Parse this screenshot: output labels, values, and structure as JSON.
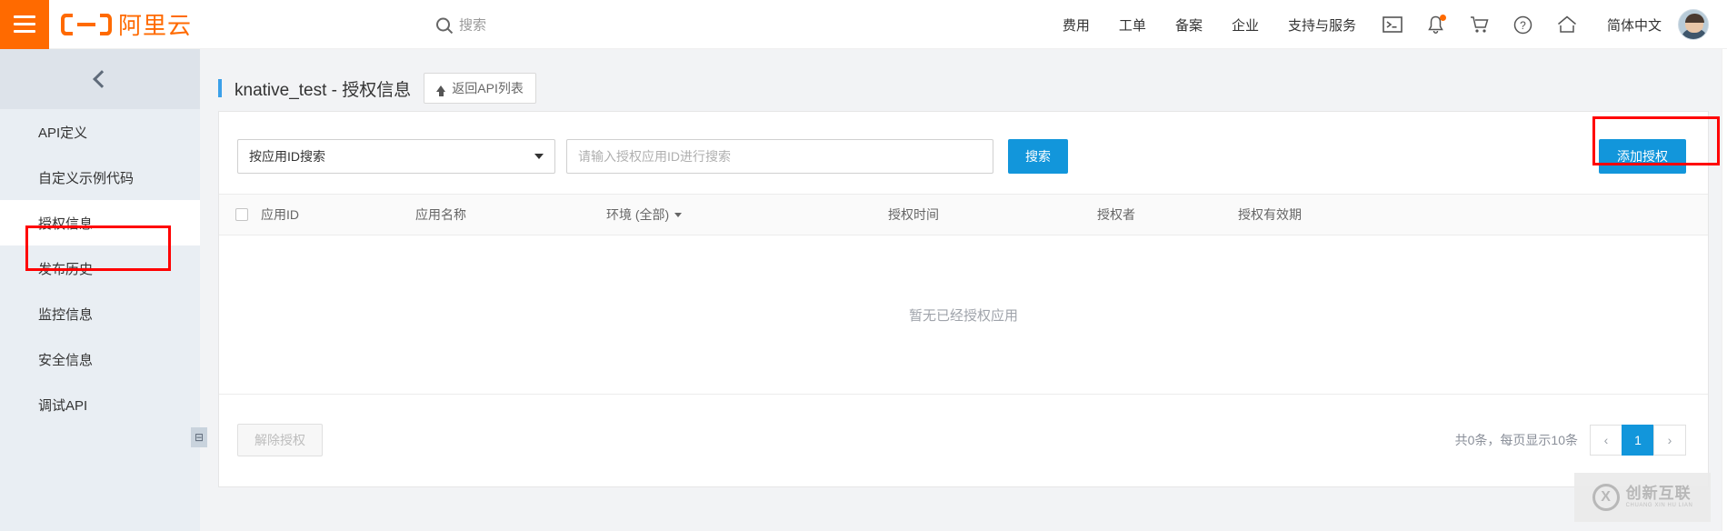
{
  "header": {
    "menu_icon": "hamburger-menu-icon",
    "logo_text": "阿里云",
    "search_placeholder": "搜索",
    "nav_links": [
      {
        "label": "费用"
      },
      {
        "label": "工单"
      },
      {
        "label": "备案"
      },
      {
        "label": "企业"
      },
      {
        "label": "支持与服务"
      }
    ],
    "icons": [
      {
        "name": "terminal-icon"
      },
      {
        "name": "bell-icon"
      },
      {
        "name": "cart-icon"
      },
      {
        "name": "help-icon"
      },
      {
        "name": "home-icon"
      }
    ],
    "language": "简体中文",
    "avatar_alt": "user-avatar"
  },
  "sidebar": {
    "collapse_icon": "chevron-left-icon",
    "items": [
      {
        "label": "API定义",
        "active": false
      },
      {
        "label": "自定义示例代码",
        "active": false
      },
      {
        "label": "授权信息",
        "active": true
      },
      {
        "label": "发布历史",
        "active": false
      },
      {
        "label": "监控信息",
        "active": false
      },
      {
        "label": "安全信息",
        "active": false
      },
      {
        "label": "调试API",
        "active": false
      }
    ]
  },
  "main": {
    "page_title": "knative_test - 授权信息",
    "back_button": "返回API列表",
    "filter": {
      "select_value": "按应用ID搜索",
      "input_value": "",
      "input_placeholder": "请输入授权应用ID进行搜索",
      "search_button": "搜索"
    },
    "add_auth_button": "添加授权",
    "table": {
      "columns": [
        "应用ID",
        "应用名称",
        "环境 (全部)",
        "授权时间",
        "授权者",
        "授权有效期"
      ],
      "rows": [],
      "empty_text": "暂无已经授权应用"
    },
    "footer": {
      "revoke_button": "解除授权",
      "pager_text": "共0条，每页显示10条",
      "prev": "‹",
      "current_page": "1",
      "next": "›"
    },
    "panel_toggle_icon": "panel-collapse-icon"
  },
  "watermark": {
    "mark": "X",
    "name_cn": "创新互联",
    "name_en": "CHUANG XIN HU LIAN"
  },
  "colors": {
    "brand_orange": "#ff6a00",
    "primary_blue": "#1296db",
    "annotation_red": "#ff0000",
    "sidebar_bg": "#e9eef3"
  }
}
